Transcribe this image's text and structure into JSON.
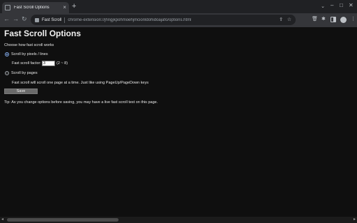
{
  "tab": {
    "title": "Fast Scroll Options",
    "close": "×",
    "new_tab": "+"
  },
  "window_controls": {
    "tab_search": "⌄",
    "minimize": "–",
    "maximize": "□",
    "close": "✕"
  },
  "toolbar": {
    "back": "←",
    "forward": "→",
    "reload": "↻",
    "extension_name": "Fast Scroll",
    "url": "chrome-extension://jhngjkpohmoehjmcionldohidoajafo/options.html",
    "share_icon": "⇪",
    "bookmark_icon": "☆",
    "trash_icon": "🗑",
    "extensions_icon": "✱",
    "menu_icon": "⋮"
  },
  "page": {
    "title": "Fast Scroll Options",
    "intro": "Choose how fast scroll works",
    "option_pixels": {
      "label": "Scroll by pixels / lines",
      "checked": true
    },
    "factor": {
      "label": "Fast scroll factor:",
      "value": "3",
      "range": "(2 ~ 8)"
    },
    "option_pages": {
      "label": "Scroll by pages",
      "checked": false
    },
    "pages_description": "Fast scroll will scroll one page at a time. Just like using PageUp/PageDown keys",
    "save_label": "Save",
    "tip": "Tip: As you change options before saving, you may have a live fast scroll test on this page."
  },
  "scrollbar": {
    "left_arrow": "◂",
    "right_arrow": "▸"
  }
}
